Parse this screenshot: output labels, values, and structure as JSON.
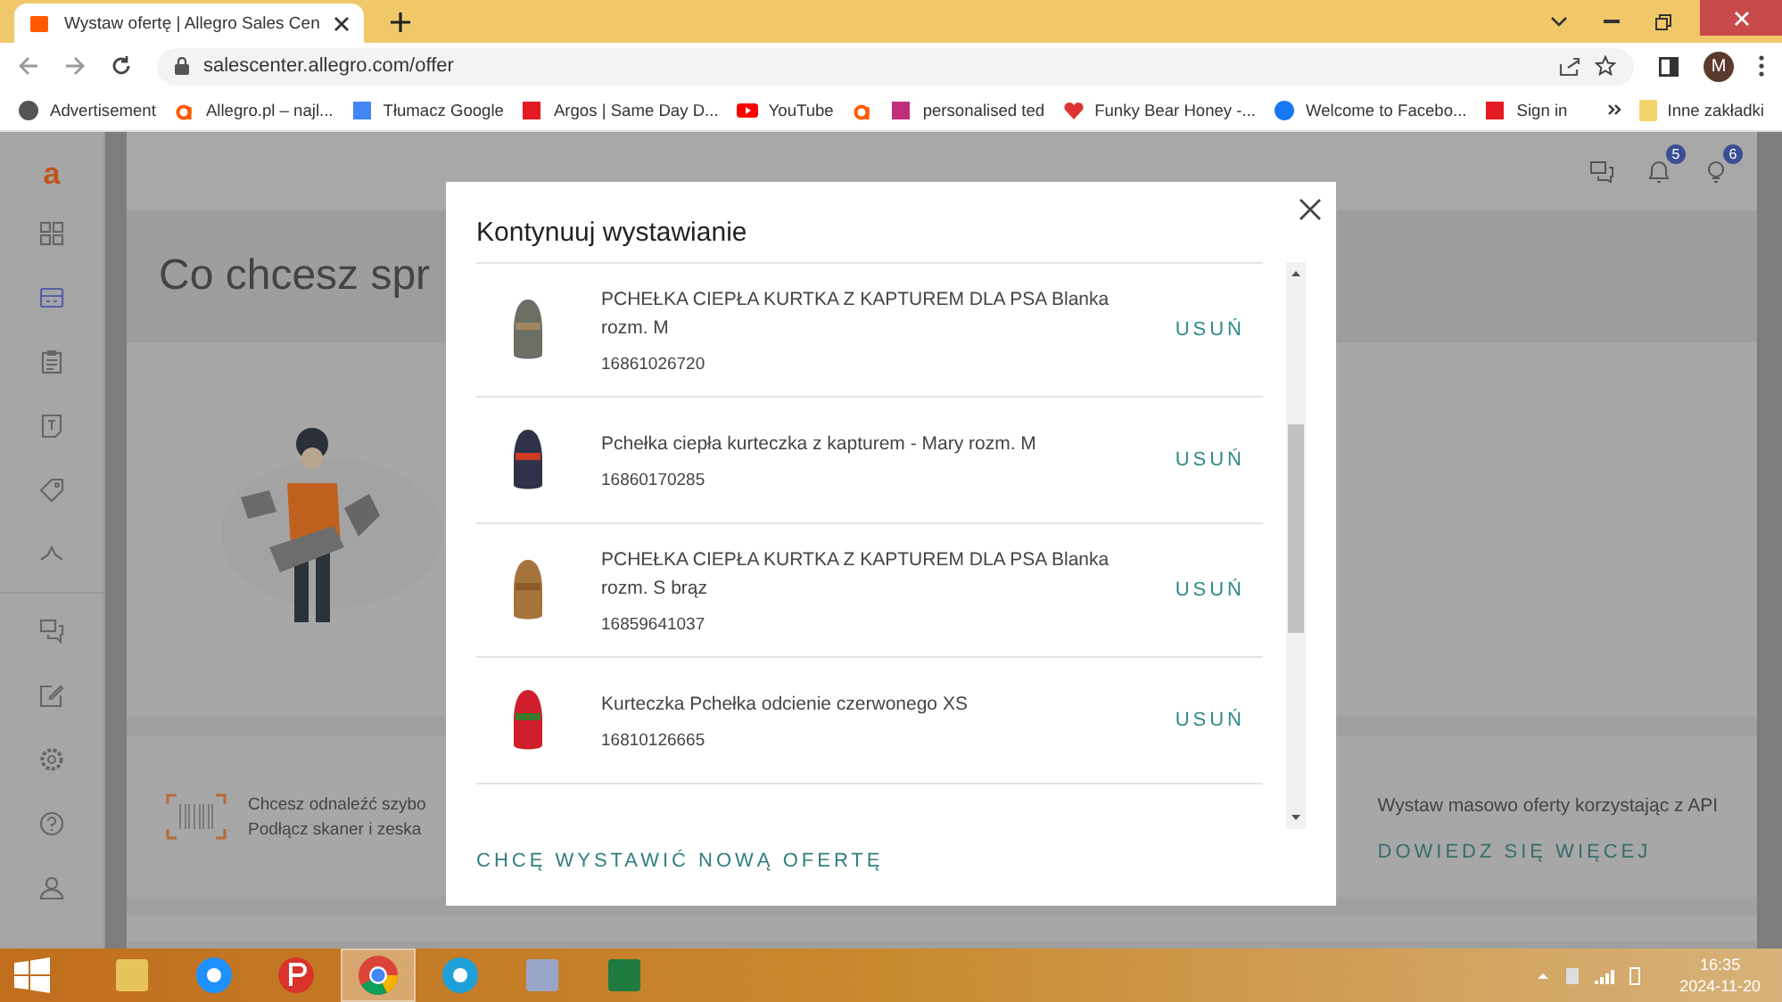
{
  "browser": {
    "tabs": [
      {
        "title": "Wystaw ofertę | Allegro Sales Cen",
        "selected": true
      }
    ],
    "address": "salescenter.allegro.com/offer",
    "profile": "M",
    "bookmarks": [
      {
        "kind": "globe",
        "label": "Advertisement"
      },
      {
        "kind": "allegro",
        "label": "Allegro.pl – najl..."
      },
      {
        "kind": "translate",
        "label": "Tłumacz Google"
      },
      {
        "kind": "argos",
        "label": "Argos | Same Day D..."
      },
      {
        "kind": "youtube",
        "label": "YouTube"
      },
      {
        "kind": "allegro"
      },
      {
        "kind": "gift",
        "label": "personalised ted"
      },
      {
        "kind": "heart",
        "label": "Funky Bear Honey -..."
      },
      {
        "kind": "facebook",
        "label": "Welcome to Facebo..."
      },
      {
        "kind": "argos",
        "label": "Sign in"
      }
    ],
    "other_bookmarks": "Inne zakładki"
  },
  "sidebar": {
    "logo": "a",
    "items": [
      {
        "kind": "grid",
        "selected": false
      },
      {
        "kind": "store",
        "selected": true
      },
      {
        "kind": "clipboard",
        "selected": false
      },
      {
        "kind": "doc",
        "selected": false
      },
      {
        "kind": "tag",
        "selected": false
      },
      {
        "kind": "chart",
        "selected": false
      },
      {
        "kind": "chat",
        "selected": false
      },
      {
        "kind": "edit",
        "selected": false
      },
      {
        "kind": "gear",
        "selected": false
      },
      {
        "kind": "help",
        "selected": false
      },
      {
        "kind": "user",
        "selected": false
      }
    ]
  },
  "header": {
    "notifications": "5",
    "tips": "6"
  },
  "page": {
    "heading": "Co chcesz spr",
    "scanner_lines": [
      "Chcesz odnaleźć szybo",
      "Podłącz skaner i zeska"
    ],
    "api_text": "Wystaw masowo oferty korzystając z API",
    "api_link": "DOWIEDZ SIĘ WIĘCEJ"
  },
  "modal": {
    "title": "Kontynuuj wystawianie",
    "items": [
      {
        "kind": "grey",
        "title": "PCHEŁKA CIEPŁA KURTKA Z KAPTUREM DLA PSA Blanka rozm. M",
        "id": "16861026720",
        "action": "USUŃ"
      },
      {
        "kind": "navy",
        "title": "Pchełka ciepła kurteczka z kapturem - Mary rozm. M",
        "id": "16860170285",
        "action": "USUŃ"
      },
      {
        "kind": "brown",
        "title": "PCHEŁKA CIEPŁA KURTKA Z KAPTUREM DLA PSA Blanka rozm. S brąz",
        "id": "16859641037",
        "action": "USUŃ"
      },
      {
        "kind": "red",
        "title": "Kurteczka Pchełka odcienie czerwonego XS",
        "id": "16810126665",
        "action": "USUŃ"
      }
    ],
    "footer_link": "CHCĘ WYSTAWIĆ NOWĄ OFERTĘ"
  },
  "taskbar": {
    "apps": [
      {
        "kind": "explorer",
        "selected": false
      },
      {
        "kind": "ie",
        "selected": false
      },
      {
        "kind": "p",
        "selected": false
      },
      {
        "kind": "chrome",
        "selected": true
      },
      {
        "kind": "edge",
        "selected": false
      },
      {
        "kind": "media",
        "selected": false
      },
      {
        "kind": "excel",
        "selected": false
      }
    ],
    "time": "16:35",
    "date": "2024-11-20"
  }
}
